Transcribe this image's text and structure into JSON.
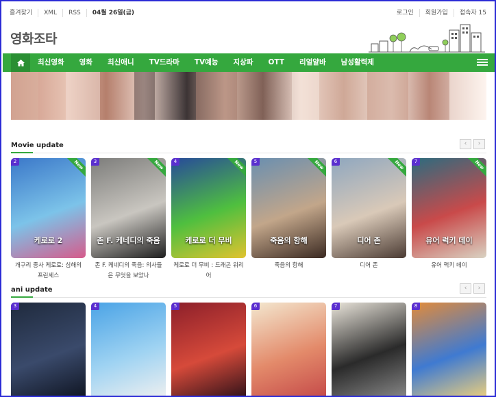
{
  "topbar": {
    "left_links": [
      "즐겨찾기",
      "XML",
      "RSS"
    ],
    "date": "04월 26일(금)",
    "right_links": [
      "로그인",
      "회원가입"
    ],
    "visitors": "접속자 15"
  },
  "logo": {
    "text": "영화조타"
  },
  "nav": {
    "home_icon": "home-icon",
    "items": [
      "최신영화",
      "영화",
      "최신애니",
      "TV드라마",
      "TV예능",
      "지상파",
      "OTT",
      "리얼얄바",
      "남성활력제"
    ],
    "menu_icon": "hamburger-icon"
  },
  "sections": {
    "movie": {
      "title": "Movie update",
      "pager": {
        "prev": "‹",
        "next": "›"
      },
      "cards": [
        {
          "rank": "2",
          "new": "New",
          "caption": "개구리 중사 케로로: 심해의 프린세스",
          "poster_text": "케로로 2",
          "colors": [
            "#3b78c9",
            "#7cc3e9",
            "#d65b8b"
          ]
        },
        {
          "rank": "3",
          "new": "New",
          "caption": "존 F. 케네디의 죽음: 의사들은 무엇을 보았나",
          "poster_text": "존 F. 케네디의 죽음",
          "colors": [
            "#7d7d7b",
            "#c9c6c0",
            "#1e1e1e"
          ]
        },
        {
          "rank": "4",
          "new": "New",
          "caption": "케로로 더 무비 : 드래곤 워리어",
          "poster_text": "케로로 더 무비",
          "colors": [
            "#274a9a",
            "#4fbf3f",
            "#e0c32f"
          ]
        },
        {
          "rank": "5",
          "new": "New",
          "caption": "죽음의 항해",
          "poster_text": "죽음의 항해",
          "colors": [
            "#6a8fb0",
            "#c2a68a",
            "#3b2a22"
          ]
        },
        {
          "rank": "6",
          "new": "New",
          "caption": "디어 존",
          "poster_text": "디어 존",
          "colors": [
            "#8fa7bf",
            "#d9c9b8",
            "#4b3b33"
          ]
        },
        {
          "rank": "7",
          "new": "New",
          "caption": "유어 럭키 데이",
          "poster_text": "유어 럭키 데이",
          "colors": [
            "#2c6b7f",
            "#c94a4a",
            "#d9d2c2"
          ]
        }
      ]
    },
    "ani": {
      "title": "ani update",
      "pager": {
        "prev": "‹",
        "next": "›"
      },
      "cards": [
        {
          "rank": "3",
          "colors": [
            "#1f2a3d",
            "#3a4a6b",
            "#0e1320"
          ]
        },
        {
          "rank": "4",
          "colors": [
            "#4aa3e6",
            "#9fd3f2",
            "#f0f0f0"
          ]
        },
        {
          "rank": "5",
          "colors": [
            "#8c1f2a",
            "#d64a3a",
            "#2a1018"
          ]
        },
        {
          "rank": "6",
          "colors": [
            "#f3e7cf",
            "#e38a6a",
            "#c44848"
          ]
        },
        {
          "rank": "7",
          "colors": [
            "#e9e4da",
            "#2a2a2a",
            "#8a8a8a"
          ]
        },
        {
          "rank": "8",
          "colors": [
            "#e28b3a",
            "#3f7ad1",
            "#f2d27a"
          ]
        }
      ]
    }
  }
}
